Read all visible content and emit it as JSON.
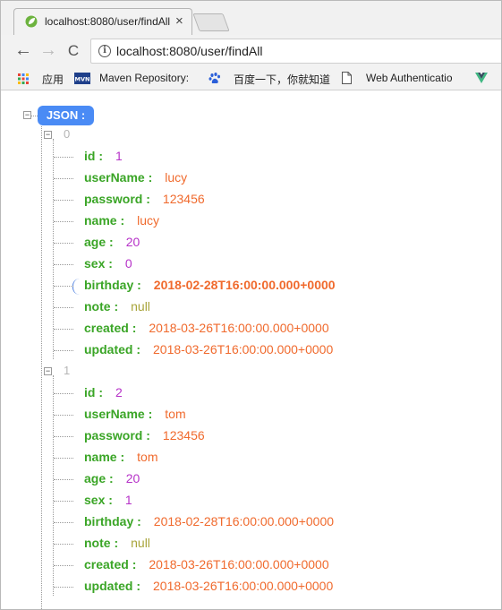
{
  "tab": {
    "title": "localhost:8080/user/findAll",
    "close": "×"
  },
  "nav": {
    "back": "←",
    "forward": "→",
    "reload": "C"
  },
  "address": {
    "url": "localhost:8080/user/findAll",
    "info": "i"
  },
  "bookmarks": [
    {
      "label": "应用",
      "icon": "apps-grid-icon"
    },
    {
      "label": "Maven Repository:",
      "icon": "mvn-icon"
    },
    {
      "label": "百度一下，你就知道",
      "icon": "baidu-paw-icon"
    },
    {
      "label": "Web Authenticatio",
      "icon": "page-icon"
    }
  ],
  "json": {
    "root_label": "JSON :",
    "items": [
      {
        "index": "0",
        "fields": [
          {
            "key": "id",
            "value": "1",
            "type": "num"
          },
          {
            "key": "userName",
            "value": "lucy",
            "type": "str"
          },
          {
            "key": "password",
            "value": "123456",
            "type": "str"
          },
          {
            "key": "name",
            "value": "lucy",
            "type": "str"
          },
          {
            "key": "age",
            "value": "20",
            "type": "num"
          },
          {
            "key": "sex",
            "value": "0",
            "type": "num"
          },
          {
            "key": "birthday",
            "value": "2018-02-28T16:00:00.000+0000",
            "type": "str"
          },
          {
            "key": "note",
            "value": "null",
            "type": "null"
          },
          {
            "key": "created",
            "value": "2018-03-26T16:00:00.000+0000",
            "type": "str"
          },
          {
            "key": "updated",
            "value": "2018-03-26T16:00:00.000+0000",
            "type": "str"
          }
        ]
      },
      {
        "index": "1",
        "fields": [
          {
            "key": "id",
            "value": "2",
            "type": "num"
          },
          {
            "key": "userName",
            "value": "tom",
            "type": "str"
          },
          {
            "key": "password",
            "value": "123456",
            "type": "str"
          },
          {
            "key": "name",
            "value": "tom",
            "type": "str"
          },
          {
            "key": "age",
            "value": "20",
            "type": "num"
          },
          {
            "key": "sex",
            "value": "1",
            "type": "num"
          },
          {
            "key": "birthday",
            "value": "2018-02-28T16:00:00.000+0000",
            "type": "str"
          },
          {
            "key": "note",
            "value": "null",
            "type": "null"
          },
          {
            "key": "created",
            "value": "2018-03-26T16:00:00.000+0000",
            "type": "str"
          },
          {
            "key": "updated",
            "value": "2018-03-26T16:00:00.000+0000",
            "type": "str"
          }
        ]
      }
    ],
    "colon": ":"
  },
  "colors": {
    "key": "#3aa526",
    "number": "#b632c8",
    "string": "#f06a2d",
    "null": "#a8a43a",
    "badge": "#4a8bf5"
  }
}
